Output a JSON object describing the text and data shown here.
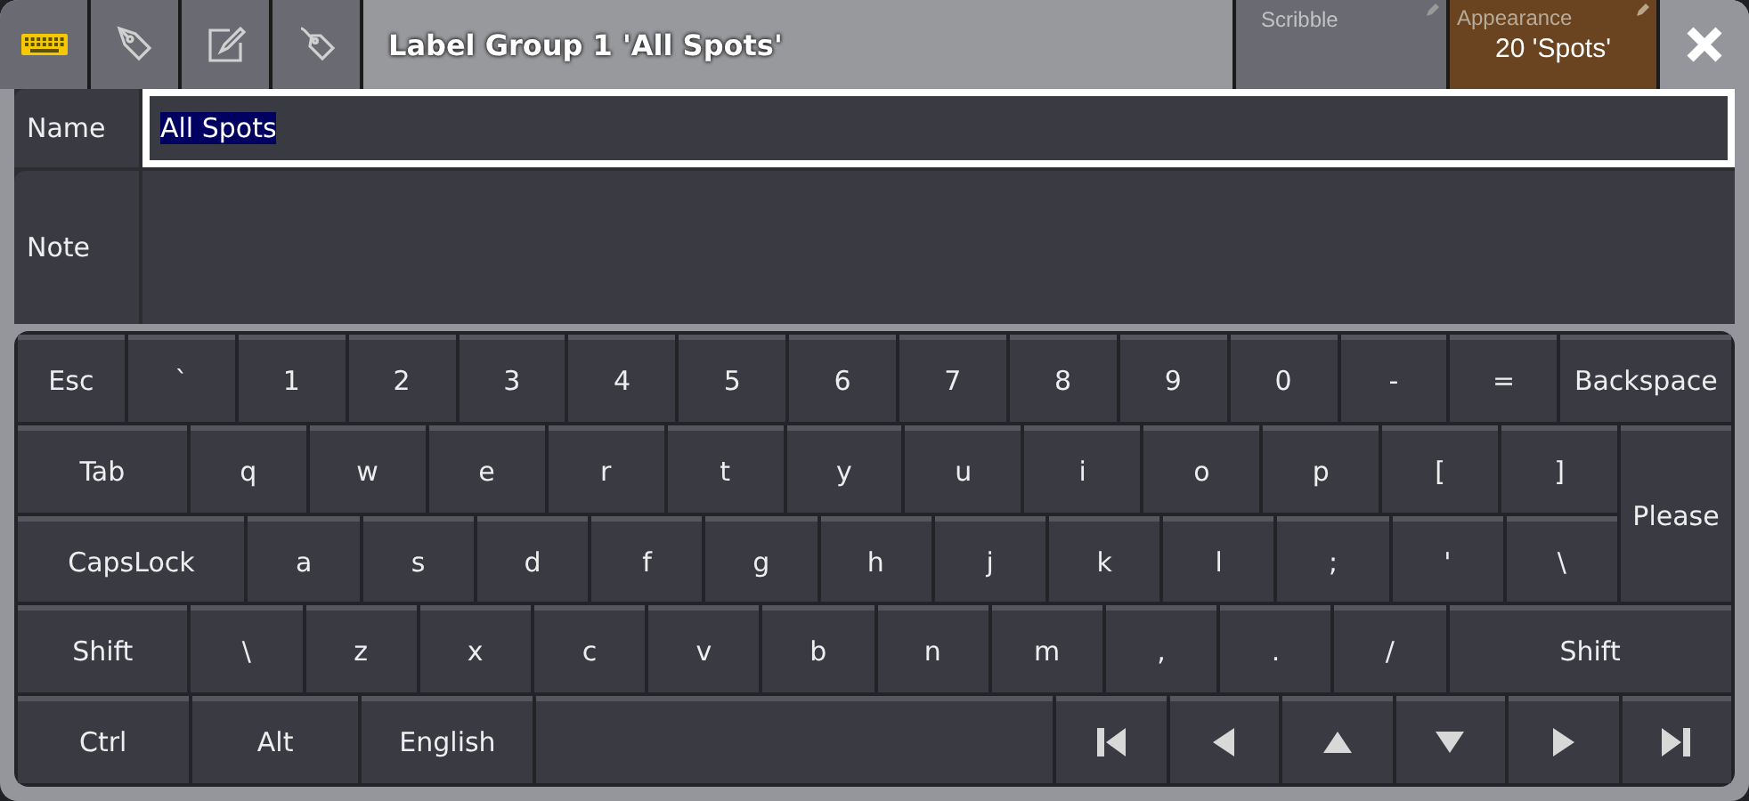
{
  "toolbar": {
    "tabs": [
      {
        "kind": "keyboard",
        "selected": true
      },
      {
        "kind": "pen",
        "selected": false
      },
      {
        "kind": "edit",
        "selected": false
      },
      {
        "kind": "tag",
        "selected": false
      }
    ]
  },
  "window": {
    "title": "Label Group 1 'All Spots'"
  },
  "scribble": {
    "label": "Scribble"
  },
  "appearance": {
    "label": "Appearance",
    "value": "20 'Spots'"
  },
  "fields": [
    {
      "label": "Name",
      "value": "All Spots",
      "focused": true
    },
    {
      "label": "Note",
      "focused": false
    }
  ],
  "keyboard": {
    "rows": [
      [
        {
          "kind": "text",
          "label": "Esc"
        },
        {
          "kind": "text",
          "label": "`"
        },
        {
          "kind": "text",
          "label": "1"
        },
        {
          "kind": "text",
          "label": "2"
        },
        {
          "kind": "text",
          "label": "3"
        },
        {
          "kind": "text",
          "label": "4"
        },
        {
          "kind": "text",
          "label": "5"
        },
        {
          "kind": "text",
          "label": "6"
        },
        {
          "kind": "text",
          "label": "7"
        },
        {
          "kind": "text",
          "label": "8"
        },
        {
          "kind": "text",
          "label": "9"
        },
        {
          "kind": "text",
          "label": "0"
        },
        {
          "kind": "text",
          "label": "-"
        },
        {
          "kind": "text",
          "label": "="
        },
        {
          "kind": "text",
          "label": "Backspace"
        }
      ],
      [
        {
          "kind": "text",
          "label": "Tab"
        },
        {
          "kind": "text",
          "label": "q"
        },
        {
          "kind": "text",
          "label": "w"
        },
        {
          "kind": "text",
          "label": "e"
        },
        {
          "kind": "text",
          "label": "r"
        },
        {
          "kind": "text",
          "label": "t"
        },
        {
          "kind": "text",
          "label": "y"
        },
        {
          "kind": "text",
          "label": "u"
        },
        {
          "kind": "text",
          "label": "i"
        },
        {
          "kind": "text",
          "label": "o"
        },
        {
          "kind": "text",
          "label": "p"
        },
        {
          "kind": "text",
          "label": "["
        },
        {
          "kind": "text",
          "label": "]"
        }
      ],
      [
        {
          "kind": "text",
          "label": "CapsLock"
        },
        {
          "kind": "text",
          "label": "a"
        },
        {
          "kind": "text",
          "label": "s"
        },
        {
          "kind": "text",
          "label": "d"
        },
        {
          "kind": "text",
          "label": "f"
        },
        {
          "kind": "text",
          "label": "g"
        },
        {
          "kind": "text",
          "label": "h"
        },
        {
          "kind": "text",
          "label": "j"
        },
        {
          "kind": "text",
          "label": "k"
        },
        {
          "kind": "text",
          "label": "l"
        },
        {
          "kind": "text",
          "label": ";"
        },
        {
          "kind": "text",
          "label": "'"
        },
        {
          "kind": "text",
          "label": "\\"
        }
      ],
      [
        {
          "kind": "text",
          "label": "Shift"
        },
        {
          "kind": "text",
          "label": "\\"
        },
        {
          "kind": "text",
          "label": "z"
        },
        {
          "kind": "text",
          "label": "x"
        },
        {
          "kind": "text",
          "label": "c"
        },
        {
          "kind": "text",
          "label": "v"
        },
        {
          "kind": "text",
          "label": "b"
        },
        {
          "kind": "text",
          "label": "n"
        },
        {
          "kind": "text",
          "label": "m"
        },
        {
          "kind": "text",
          "label": ","
        },
        {
          "kind": "text",
          "label": "."
        },
        {
          "kind": "text",
          "label": "/"
        },
        {
          "kind": "text",
          "label": "Shift"
        }
      ],
      [
        {
          "kind": "text",
          "label": "Ctrl"
        },
        {
          "kind": "text",
          "label": "Alt"
        },
        {
          "kind": "text",
          "label": "English"
        },
        {
          "kind": "space"
        },
        {
          "kind": "first"
        },
        {
          "kind": "left"
        },
        {
          "kind": "up"
        },
        {
          "kind": "down"
        },
        {
          "kind": "right"
        },
        {
          "kind": "last"
        }
      ]
    ],
    "side_key": {
      "label": "Please"
    }
  }
}
